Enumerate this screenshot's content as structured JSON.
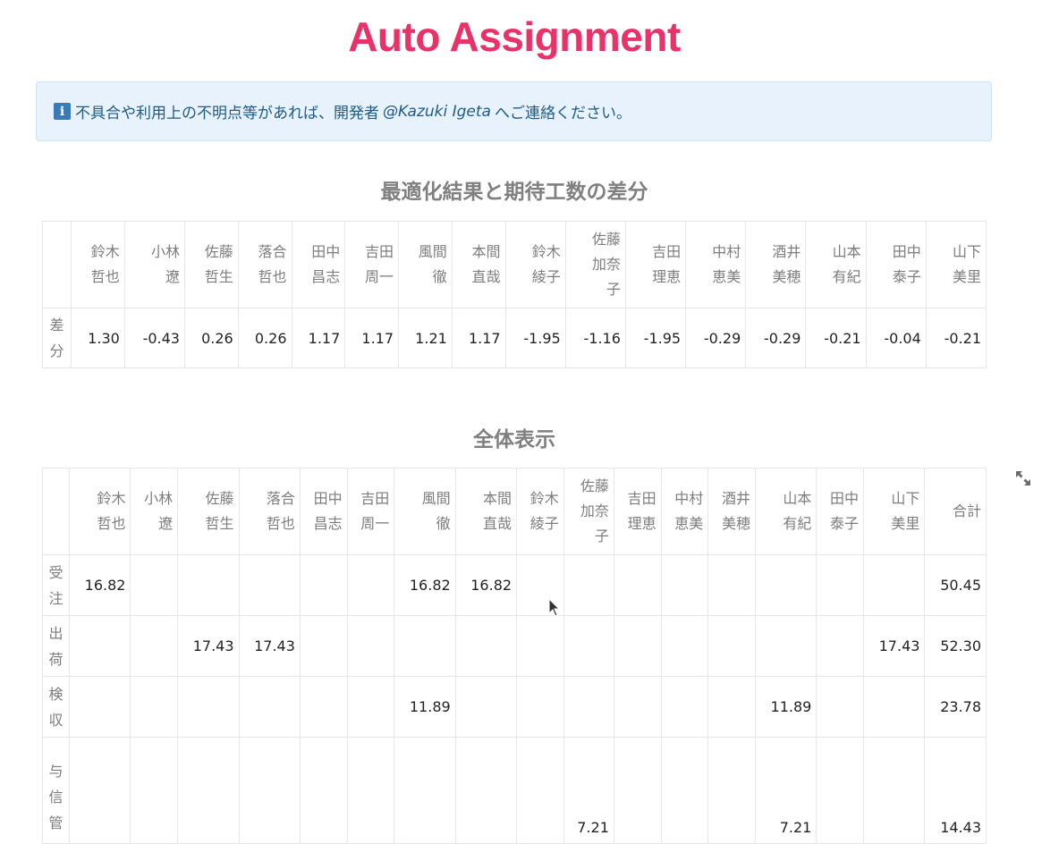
{
  "page": {
    "title": "Auto Assignment",
    "alert": {
      "icon": "info-icon",
      "text_before": "不具合や利用上の不明点等があれば、開発者",
      "mention": "@Kazuki Igeta",
      "text_after": "へご連絡ください。"
    }
  },
  "diff_table": {
    "title": "最適化結果と期待工数の差分",
    "columns": [
      "鈴木哲也",
      "小林遼",
      "佐藤哲生",
      "落合哲也",
      "田中昌志",
      "吉田周一",
      "風間徹",
      "本間直哉",
      "鈴木綾子",
      "佐藤加奈子",
      "吉田理恵",
      "中村恵美",
      "酒井美穂",
      "山本有紀",
      "田中泰子",
      "山下美里"
    ],
    "rows": [
      {
        "label": "差分",
        "values": [
          "1.30",
          "-0.43",
          "0.26",
          "0.26",
          "1.17",
          "1.17",
          "1.21",
          "1.17",
          "-1.95",
          "-1.16",
          "-1.95",
          "-0.29",
          "-0.29",
          "-0.21",
          "-0.04",
          "-0.21"
        ]
      }
    ]
  },
  "full_table": {
    "title": "全体表示",
    "expand_icon": "expand-icon",
    "columns": [
      "鈴木哲也",
      "小林遼",
      "佐藤哲生",
      "落合哲也",
      "田中昌志",
      "吉田周一",
      "風間徹",
      "本間直哉",
      "鈴木綾子",
      "佐藤加奈子",
      "吉田理恵",
      "中村恵美",
      "酒井美穂",
      "山本有紀",
      "田中泰子",
      "山下美里",
      "合計"
    ],
    "rows": [
      {
        "label": "受注",
        "values": [
          "16.82",
          "",
          "",
          "",
          "",
          "",
          "16.82",
          "16.82",
          "",
          "",
          "",
          "",
          "",
          "",
          "",
          "",
          "50.45"
        ]
      },
      {
        "label": "出荷",
        "values": [
          "",
          "",
          "17.43",
          "17.43",
          "",
          "",
          "",
          "",
          "",
          "",
          "",
          "",
          "",
          "",
          "",
          "17.43",
          "52.30"
        ]
      },
      {
        "label": "検収",
        "values": [
          "",
          "",
          "",
          "",
          "",
          "",
          "11.89",
          "",
          "",
          "",
          "",
          "",
          "",
          "11.89",
          "",
          "",
          "23.78"
        ]
      },
      {
        "label": "与信管",
        "values": [
          "",
          "",
          "",
          "",
          "",
          "",
          "",
          "",
          "",
          "7.21",
          "",
          "",
          "",
          "7.21",
          "",
          "",
          "14.43"
        ]
      }
    ]
  }
}
